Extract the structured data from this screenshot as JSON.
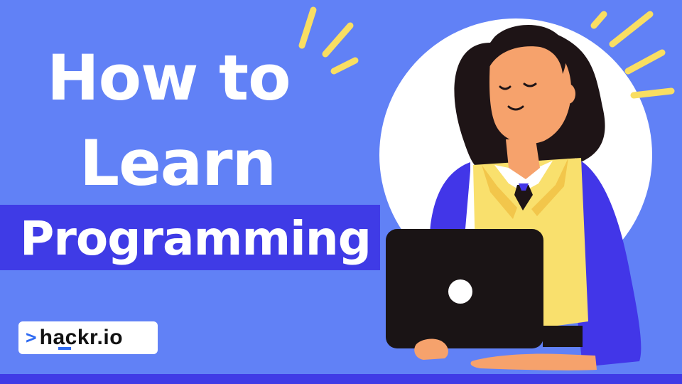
{
  "title": {
    "line1": "How to",
    "line2": "Learn",
    "line3": "Programming"
  },
  "brand": {
    "prefix": ">",
    "name": "hackr.io"
  },
  "colors": {
    "background": "#6181f6",
    "banner": "#3f3be6",
    "accent_rays": "#f9de62",
    "vest": "#f9e06d",
    "sleeve": "#4236e8",
    "skin": "#f6a26c",
    "hair": "#1e1416",
    "laptop": "#1a1415",
    "logo_blue": "#2f6bf2"
  },
  "icons": {
    "logo_chevron": "chevron-right-icon",
    "laptop_camera": "circle-icon"
  }
}
